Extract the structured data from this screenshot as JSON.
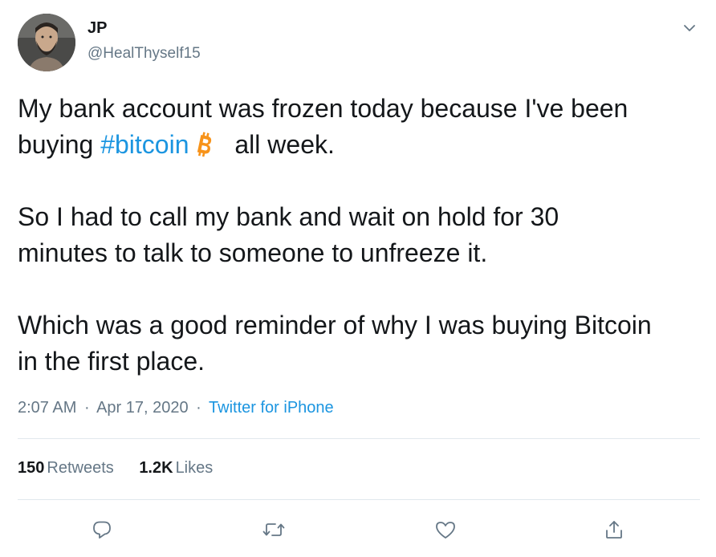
{
  "author": {
    "name": "JP",
    "handle": "@HealThyself15",
    "avatar": "avatar-photo"
  },
  "tweet": {
    "line1": "My bank account was frozen today because I've been",
    "line2_prefix": "buying ",
    "hashtag": "#bitcoin",
    "line2_suffix": " all week.",
    "paragraph2_line1": "So I had to call my bank and wait on hold for 30",
    "paragraph2_line2": "minutes to talk to someone to unfreeze it.",
    "paragraph3_line1": "Which was a good reminder of why I was buying Bitcoin",
    "paragraph3_line2": "in the first place."
  },
  "meta": {
    "time": "2:07 AM",
    "separator": "·",
    "date": "Apr 17, 2020",
    "source": "Twitter for iPhone"
  },
  "stats": {
    "retweets_count": "150",
    "retweets_label": "Retweets",
    "likes_count": "1.2K",
    "likes_label": "Likes"
  },
  "icons": {
    "more": "chevron-down-icon",
    "emoji": "bitcoin-icon",
    "reply": "reply-icon",
    "retweet": "retweet-icon",
    "like": "heart-icon",
    "share": "share-icon"
  },
  "colors": {
    "link": "#1b95e0",
    "secondary_text": "#657786",
    "bitcoin": "#f7931a",
    "divider": "#e1e8ed"
  }
}
